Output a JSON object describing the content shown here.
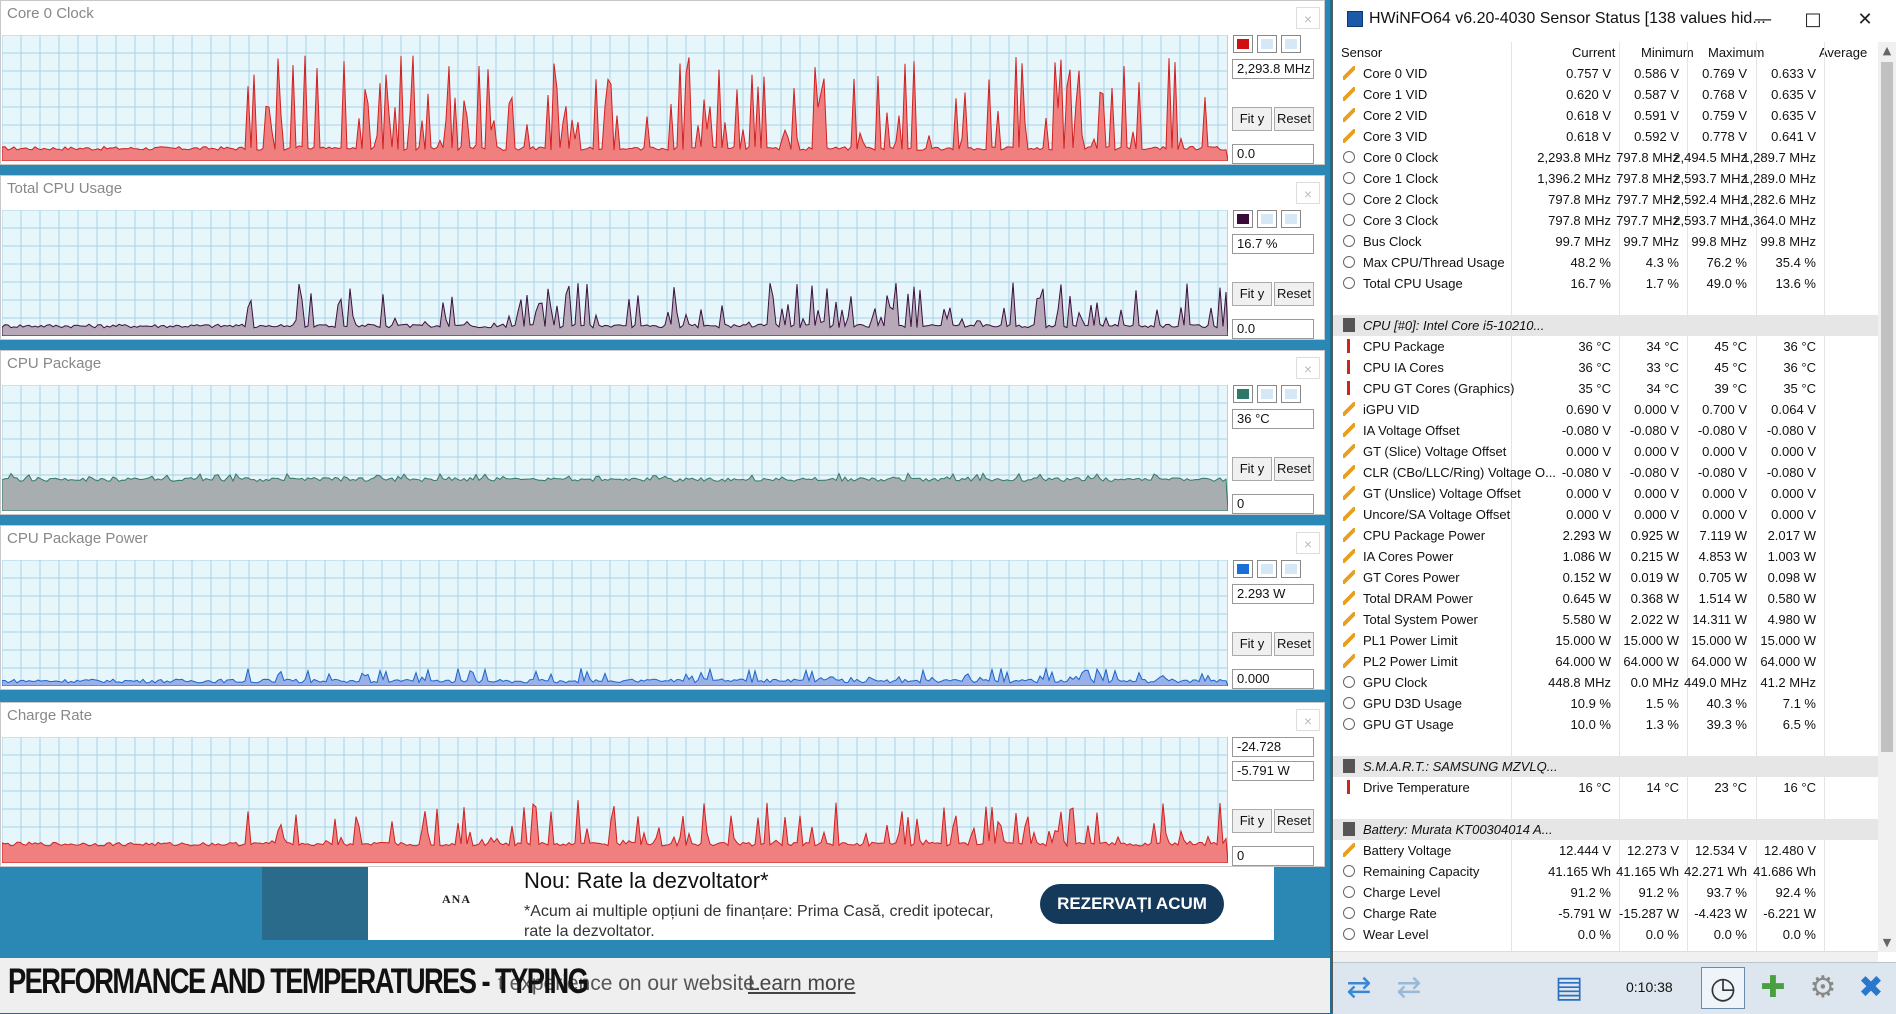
{
  "background": {
    "ad": {
      "logo": "ANA",
      "title": "Nou: Rate la dezvoltator*",
      "body": "*Acum ai multiple opțiuni de finanțare: Prima Casă, credit ipotecar, rate la dezvoltator.",
      "cta": "REZERVAȚI ACUM"
    },
    "cookie": {
      "text": "t experience on our website.",
      "learn_more": "Learn more"
    },
    "caption": "PERFORMANCE AND TEMPERATURES - TYPING"
  },
  "graphs": [
    {
      "title": "Core 0 Clock",
      "current": "2,293.8 MHz",
      "min_box": "0.0",
      "fit": "Fit y",
      "reset": "Reset",
      "color": "#f07f7f",
      "line": "#d02020",
      "swatch": "#d01010"
    },
    {
      "title": "Total CPU Usage",
      "current": "16.7 %",
      "min_box": "0.0",
      "fit": "Fit y",
      "reset": "Reset",
      "color": "#b8a9b8",
      "line": "#3a1040",
      "swatch": "#3a0a3a"
    },
    {
      "title": "CPU Package",
      "current": "36 °C",
      "min_box": "0",
      "fit": "Fit y",
      "reset": "Reset",
      "color": "#a8aeb0",
      "line": "#2e7a66",
      "swatch": "#2f7766"
    },
    {
      "title": "CPU Package Power",
      "current": "2.293 W",
      "min_box": "0.000",
      "fit": "Fit y",
      "reset": "Reset",
      "color": "#9ab0e8",
      "line": "#1a66cc",
      "swatch": "#1a6fd6"
    },
    {
      "title": "Charge Rate",
      "current": "-5.791 W",
      "max_box": "-24.728",
      "min_box": "0",
      "fit": "Fit y",
      "reset": "Reset",
      "color": "#f07f7f",
      "line": "#d02020",
      "swatch": "#d01010"
    }
  ],
  "hwinfo": {
    "title": "HWiNFO64 v6.20-4030 Sensor Status [138 values hid...",
    "columns": [
      "Sensor",
      "Current",
      "Minimum",
      "Maximum",
      "Average"
    ],
    "rows": [
      {
        "t": "v",
        "n": "Core 0 VID",
        "c": "0.757 V",
        "mi": "0.586 V",
        "ma": "0.769 V",
        "a": "0.633 V"
      },
      {
        "t": "v",
        "n": "Core 1 VID",
        "c": "0.620 V",
        "mi": "0.587 V",
        "ma": "0.768 V",
        "a": "0.635 V"
      },
      {
        "t": "v",
        "n": "Core 2 VID",
        "c": "0.618 V",
        "mi": "0.591 V",
        "ma": "0.759 V",
        "a": "0.635 V"
      },
      {
        "t": "v",
        "n": "Core 3 VID",
        "c": "0.618 V",
        "mi": "0.592 V",
        "ma": "0.778 V",
        "a": "0.641 V"
      },
      {
        "t": "c",
        "n": "Core 0 Clock",
        "c": "2,293.8 MHz",
        "mi": "797.8 MHz",
        "ma": "2,494.5 MHz",
        "a": "1,289.7 MHz"
      },
      {
        "t": "c",
        "n": "Core 1 Clock",
        "c": "1,396.2 MHz",
        "mi": "797.8 MHz",
        "ma": "2,593.7 MHz",
        "a": "1,289.0 MHz"
      },
      {
        "t": "c",
        "n": "Core 2 Clock",
        "c": "797.8 MHz",
        "mi": "797.7 MHz",
        "ma": "2,592.4 MHz",
        "a": "1,282.6 MHz"
      },
      {
        "t": "c",
        "n": "Core 3 Clock",
        "c": "797.8 MHz",
        "mi": "797.7 MHz",
        "ma": "2,593.7 MHz",
        "a": "1,364.0 MHz"
      },
      {
        "t": "c",
        "n": "Bus Clock",
        "c": "99.7 MHz",
        "mi": "99.7 MHz",
        "ma": "99.8 MHz",
        "a": "99.8 MHz"
      },
      {
        "t": "c",
        "n": "Max CPU/Thread Usage",
        "c": "48.2 %",
        "mi": "4.3 %",
        "ma": "76.2 %",
        "a": "35.4 %"
      },
      {
        "t": "c",
        "n": "Total CPU Usage",
        "c": "16.7 %",
        "mi": "1.7 %",
        "ma": "49.0 %",
        "a": "13.6 %"
      },
      {
        "t": "e",
        "n": "",
        "c": "",
        "mi": "",
        "ma": "",
        "a": ""
      },
      {
        "t": "g",
        "n": "CPU [#0]: Intel Core i5-10210...",
        "c": "",
        "mi": "",
        "ma": "",
        "a": ""
      },
      {
        "t": "t",
        "n": "CPU Package",
        "c": "36 °C",
        "mi": "34 °C",
        "ma": "45 °C",
        "a": "36 °C"
      },
      {
        "t": "t",
        "n": "CPU IA Cores",
        "c": "36 °C",
        "mi": "33 °C",
        "ma": "45 °C",
        "a": "36 °C"
      },
      {
        "t": "t",
        "n": "CPU GT Cores (Graphics)",
        "c": "35 °C",
        "mi": "34 °C",
        "ma": "39 °C",
        "a": "35 °C"
      },
      {
        "t": "v",
        "n": "iGPU VID",
        "c": "0.690 V",
        "mi": "0.000 V",
        "ma": "0.700 V",
        "a": "0.064 V"
      },
      {
        "t": "v",
        "n": "IA Voltage Offset",
        "c": "-0.080 V",
        "mi": "-0.080 V",
        "ma": "-0.080 V",
        "a": "-0.080 V"
      },
      {
        "t": "v",
        "n": "GT (Slice) Voltage Offset",
        "c": "0.000 V",
        "mi": "0.000 V",
        "ma": "0.000 V",
        "a": "0.000 V"
      },
      {
        "t": "v",
        "n": "CLR (CBo/LLC/Ring) Voltage O...",
        "c": "-0.080 V",
        "mi": "-0.080 V",
        "ma": "-0.080 V",
        "a": "-0.080 V"
      },
      {
        "t": "v",
        "n": "GT (Unslice) Voltage Offset",
        "c": "0.000 V",
        "mi": "0.000 V",
        "ma": "0.000 V",
        "a": "0.000 V"
      },
      {
        "t": "v",
        "n": "Uncore/SA Voltage Offset",
        "c": "0.000 V",
        "mi": "0.000 V",
        "ma": "0.000 V",
        "a": "0.000 V"
      },
      {
        "t": "v",
        "n": "CPU Package Power",
        "c": "2.293 W",
        "mi": "0.925 W",
        "ma": "7.119 W",
        "a": "2.017 W"
      },
      {
        "t": "v",
        "n": "IA Cores Power",
        "c": "1.086 W",
        "mi": "0.215 W",
        "ma": "4.853 W",
        "a": "1.003 W"
      },
      {
        "t": "v",
        "n": "GT Cores Power",
        "c": "0.152 W",
        "mi": "0.019 W",
        "ma": "0.705 W",
        "a": "0.098 W"
      },
      {
        "t": "v",
        "n": "Total DRAM Power",
        "c": "0.645 W",
        "mi": "0.368 W",
        "ma": "1.514 W",
        "a": "0.580 W"
      },
      {
        "t": "v",
        "n": "Total System Power",
        "c": "5.580 W",
        "mi": "2.022 W",
        "ma": "14.311 W",
        "a": "4.980 W"
      },
      {
        "t": "v",
        "n": "PL1 Power Limit",
        "c": "15.000 W",
        "mi": "15.000 W",
        "ma": "15.000 W",
        "a": "15.000 W"
      },
      {
        "t": "v",
        "n": "PL2 Power Limit",
        "c": "64.000 W",
        "mi": "64.000 W",
        "ma": "64.000 W",
        "a": "64.000 W"
      },
      {
        "t": "c",
        "n": "GPU Clock",
        "c": "448.8 MHz",
        "mi": "0.0 MHz",
        "ma": "449.0 MHz",
        "a": "41.2 MHz"
      },
      {
        "t": "c",
        "n": "GPU D3D Usage",
        "c": "10.9 %",
        "mi": "1.5 %",
        "ma": "40.3 %",
        "a": "7.1 %"
      },
      {
        "t": "c",
        "n": "GPU GT Usage",
        "c": "10.0 %",
        "mi": "1.3 %",
        "ma": "39.3 %",
        "a": "6.5 %"
      },
      {
        "t": "e",
        "n": "",
        "c": "",
        "mi": "",
        "ma": "",
        "a": ""
      },
      {
        "t": "g",
        "n": "S.M.A.R.T.: SAMSUNG MZVLQ...",
        "c": "",
        "mi": "",
        "ma": "",
        "a": ""
      },
      {
        "t": "t",
        "n": "Drive Temperature",
        "c": "16 °C",
        "mi": "14 °C",
        "ma": "23 °C",
        "a": "16 °C"
      },
      {
        "t": "e",
        "n": "",
        "c": "",
        "mi": "",
        "ma": "",
        "a": ""
      },
      {
        "t": "g",
        "n": "Battery: Murata KT00304014 A...",
        "c": "",
        "mi": "",
        "ma": "",
        "a": ""
      },
      {
        "t": "v",
        "n": "Battery Voltage",
        "c": "12.444 V",
        "mi": "12.273 V",
        "ma": "12.534 V",
        "a": "12.480 V"
      },
      {
        "t": "c",
        "n": "Remaining Capacity",
        "c": "41.165 Wh",
        "mi": "41.165 Wh",
        "ma": "42.271 Wh",
        "a": "41.686 Wh"
      },
      {
        "t": "c",
        "n": "Charge Level",
        "c": "91.2 %",
        "mi": "91.2 %",
        "ma": "93.7 %",
        "a": "92.4 %"
      },
      {
        "t": "c",
        "n": "Charge Rate",
        "c": "-5.791 W",
        "mi": "-15.287 W",
        "ma": "-4.423 W",
        "a": "-6.221 W"
      },
      {
        "t": "c",
        "n": "Wear Level",
        "c": "0.0 %",
        "mi": "0.0 %",
        "ma": "0.0 %",
        "a": "0.0 %"
      }
    ],
    "timer": "0:10:38",
    "icons": [
      "nav-arrows-icon",
      "nav-arrows-dim-icon",
      "network-icon",
      "clock-icon",
      "add-report-icon",
      "settings-icon",
      "close-x-icon"
    ]
  }
}
